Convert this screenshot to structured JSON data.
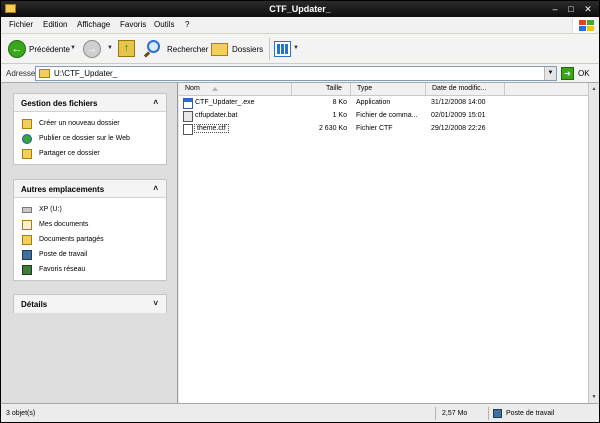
{
  "window": {
    "title": "CTF_Updater_"
  },
  "menu": [
    "Fichier",
    "Edition",
    "Affichage",
    "Favoris",
    "Outils",
    "?"
  ],
  "toolbar": {
    "back_label": "Précédente",
    "search_label": "Rechercher",
    "folders_label": "Dossiers"
  },
  "address": {
    "label": "Adresse",
    "value": "U:\\CTF_Updater_",
    "go_label": "OK"
  },
  "taskpane": {
    "file_tasks": {
      "title": "Gestion des fichiers",
      "items": [
        "Créer un nouveau dossier",
        "Publier ce dossier sur le Web",
        "Partager ce dossier"
      ]
    },
    "other_places": {
      "title": "Autres emplacements",
      "items": [
        "XP (U:)",
        "Mes documents",
        "Documents partagés",
        "Poste de travail",
        "Favoris réseau"
      ]
    },
    "details": {
      "title": "Détails"
    }
  },
  "files": {
    "columns": [
      "Nom",
      "Taille",
      "Type",
      "Date de modific..."
    ],
    "rows": [
      {
        "name": "CTF_Updater_.exe",
        "size": "8 Ko",
        "type": "Application",
        "date": "31/12/2008 14:00",
        "icon": "exe-icon"
      },
      {
        "name": "ctfupdater.bat",
        "size": "1 Ko",
        "type": "Fichier de comma...",
        "date": "02/01/2009 15:01",
        "icon": "bat-icon"
      },
      {
        "name": "theme.ctf",
        "size": "2 630 Ko",
        "type": "Fichier CTF",
        "date": "29/12/2008 22:26",
        "icon": "ctf-file-icon"
      }
    ]
  },
  "status": {
    "count": "3 objet(s)",
    "size": "2,57 Mo",
    "location": "Poste de travail"
  }
}
